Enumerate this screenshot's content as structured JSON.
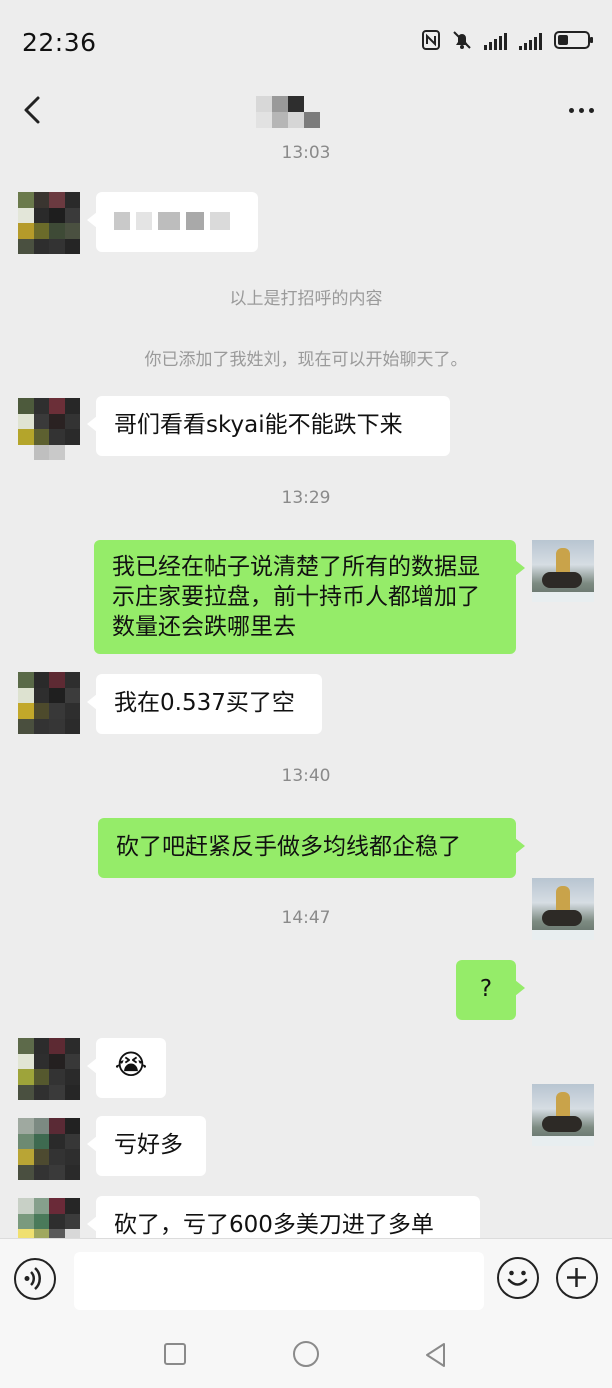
{
  "status": {
    "time": "22:36"
  },
  "chat": {
    "messages": [
      {
        "kind": "time",
        "text": "13:03"
      },
      {
        "kind": "system",
        "text": "以上是打招呼的内容"
      },
      {
        "kind": "system",
        "text": "你已添加了我姓刘，现在可以开始聊天了。"
      },
      {
        "kind": "incoming",
        "text": "哥们看看skyai能不能跌下来"
      },
      {
        "kind": "time",
        "text": "13:29"
      },
      {
        "kind": "outgoing",
        "text": "我已经在帖子说清楚了所有的数据显示庄家要拉盘，前十持币人都增加了数量还会跌哪里去"
      },
      {
        "kind": "incoming",
        "text": "我在0.537买了空"
      },
      {
        "kind": "time",
        "text": "13:40"
      },
      {
        "kind": "outgoing",
        "text": "砍了吧赶紧反手做多均线都企稳了"
      },
      {
        "kind": "time",
        "text": "14:47"
      },
      {
        "kind": "outgoing",
        "text": "?"
      },
      {
        "kind": "incoming",
        "text": "😭"
      },
      {
        "kind": "incoming",
        "text": "亏好多"
      },
      {
        "kind": "incoming",
        "text": "砍了，亏了600多美刀进了多单"
      }
    ]
  },
  "icons": {
    "back": "back-arrow-icon",
    "more": "more-dots-icon",
    "voice": "voice-icon",
    "emoji": "emoji-icon",
    "plus": "plus-icon"
  },
  "colors": {
    "background": "#ededed",
    "outgoing_bubble": "#95ec69",
    "incoming_bubble": "#ffffff",
    "timestamp": "#8a8a8a"
  }
}
